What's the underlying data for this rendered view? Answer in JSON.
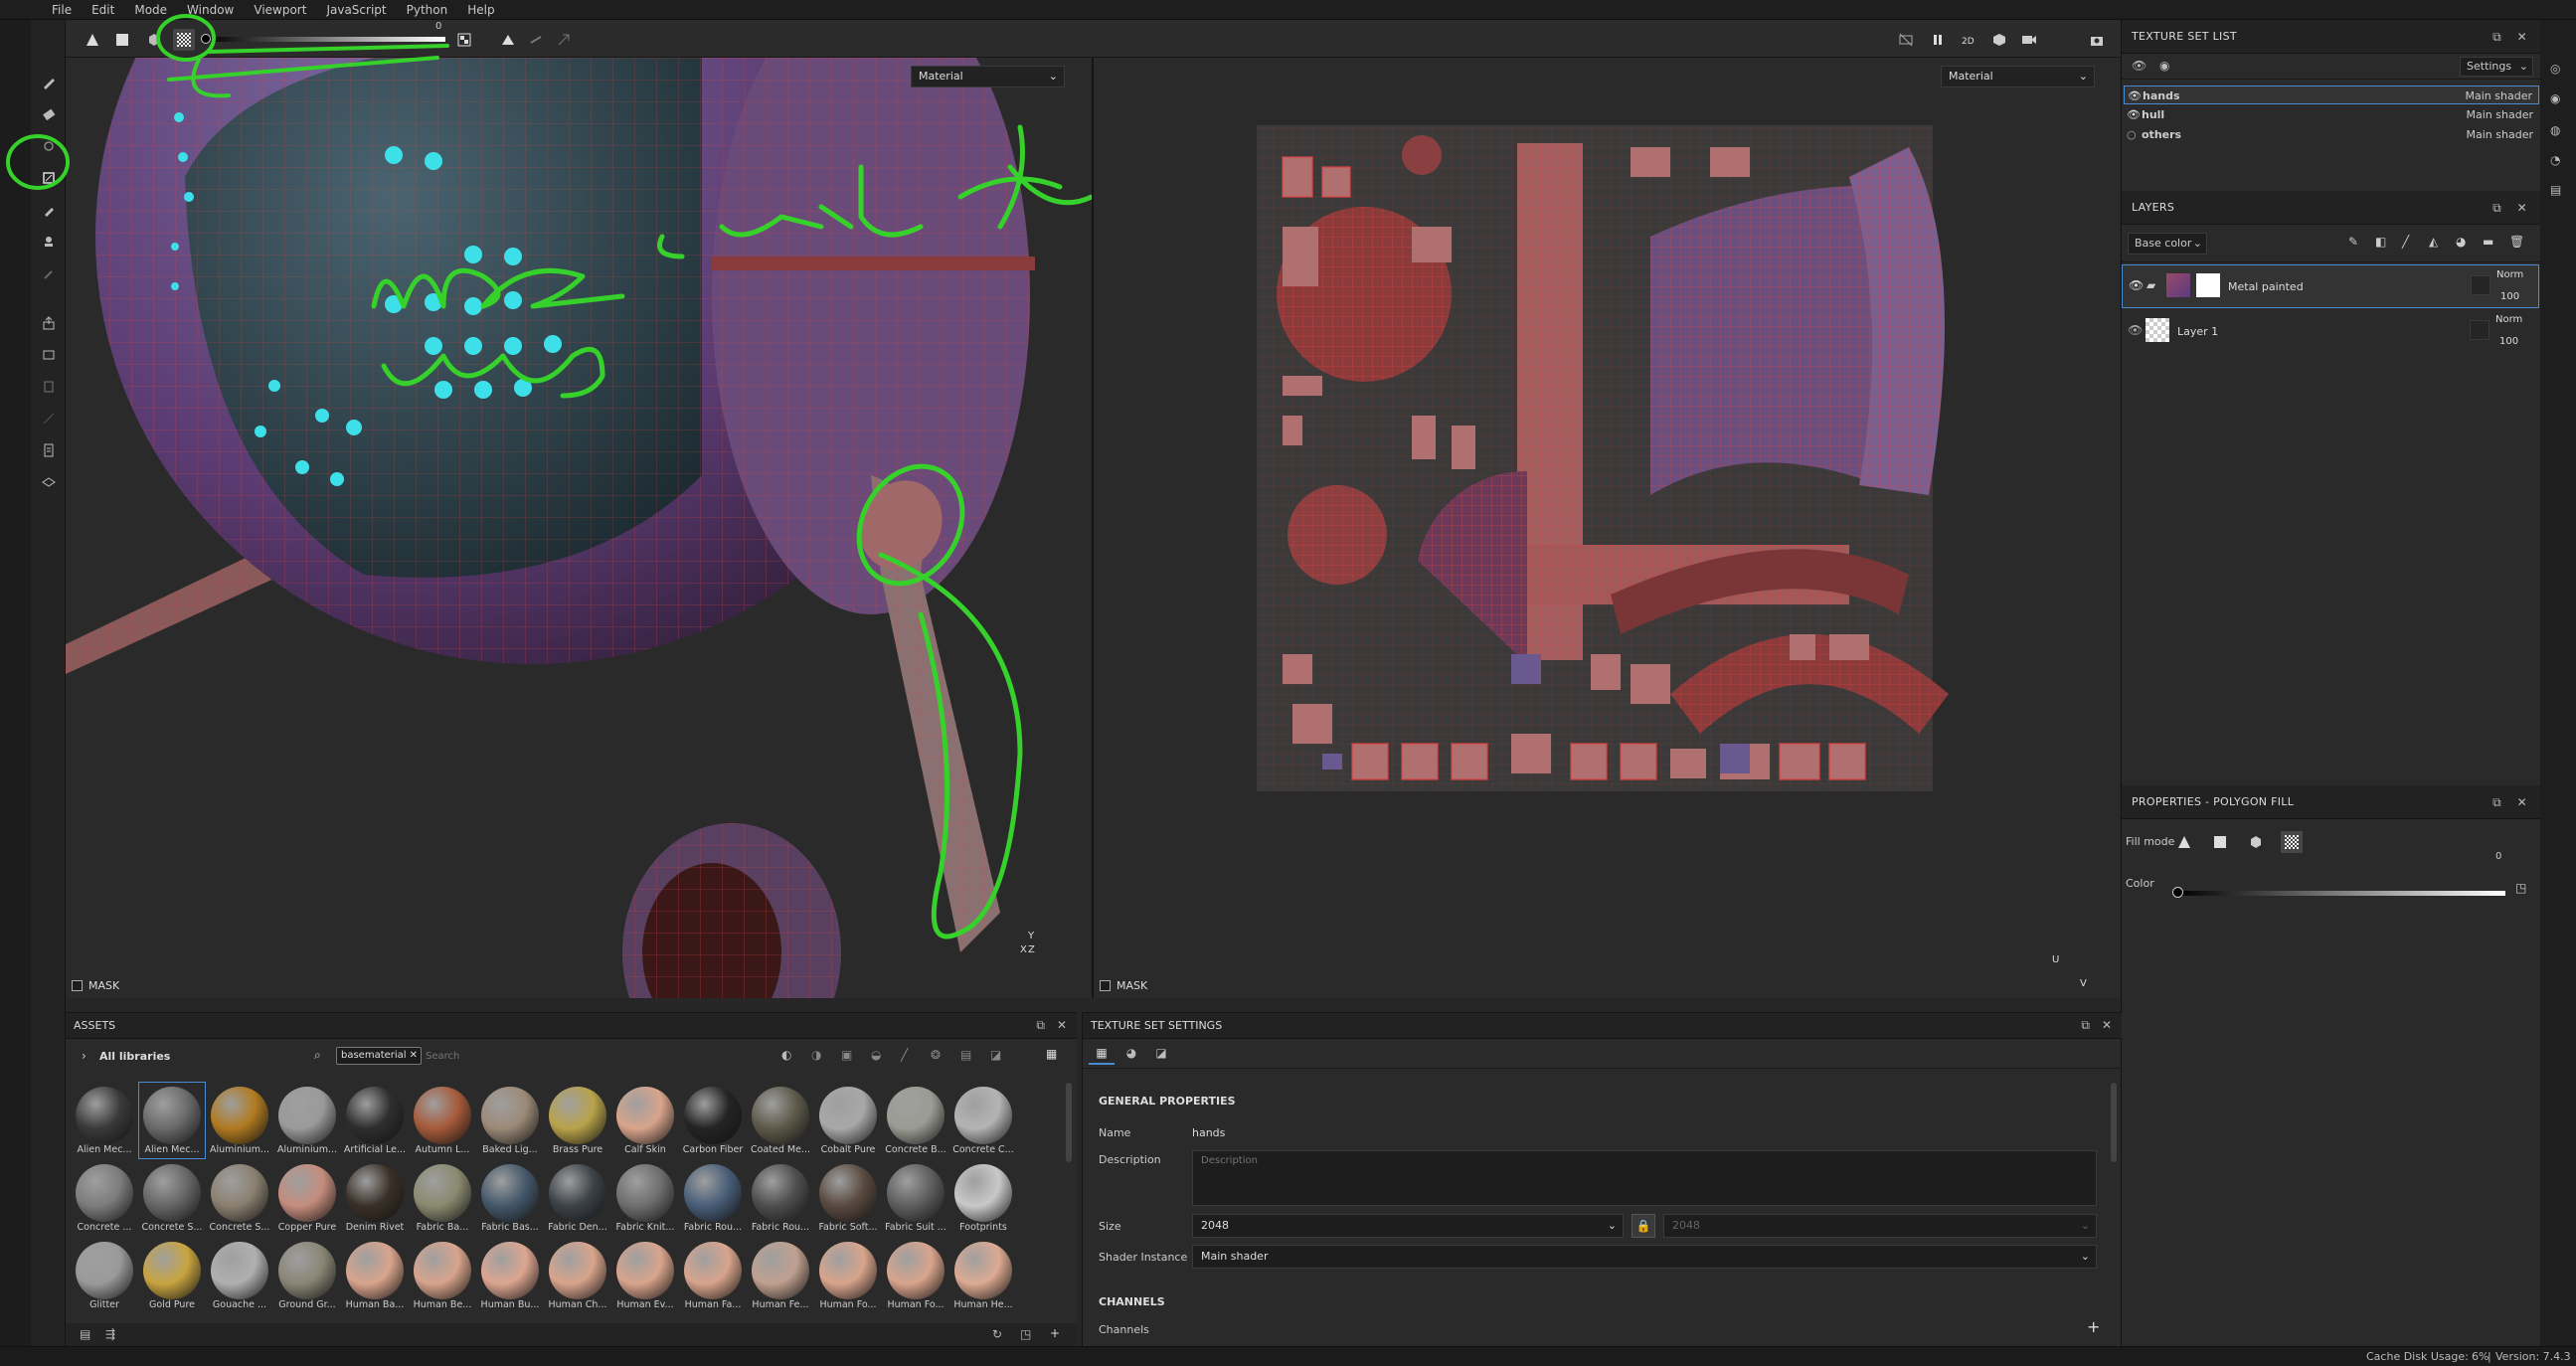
{
  "menu": [
    "File",
    "Edit",
    "Mode",
    "Window",
    "Viewport",
    "JavaScript",
    "Python",
    "Help"
  ],
  "toolbar": {
    "slider_value": "0"
  },
  "viewport_left": {
    "select": "Material",
    "mask_label": "MASK",
    "axis_x": "X",
    "axis_y": "Y",
    "axis_z": "Z"
  },
  "viewport_right": {
    "select": "Material",
    "mask_label": "MASK",
    "axis_u": "U",
    "axis_v": "V"
  },
  "annotations": {
    "line1": "mask cut the",
    "line2": "arms"
  },
  "texture_set_list": {
    "title": "TEXTURE SET LIST",
    "settings": "Settings",
    "rows": [
      {
        "name": "hands",
        "shader": "Main shader"
      },
      {
        "name": "hull",
        "shader": "Main shader"
      },
      {
        "name": "others",
        "shader": "Main shader"
      }
    ]
  },
  "layers": {
    "title": "LAYERS",
    "channel": "Base color",
    "rows": [
      {
        "name": "Metal painted",
        "blend": "Norm",
        "opacity": "100"
      },
      {
        "name": "Layer 1",
        "blend": "Norm",
        "opacity": "100"
      }
    ]
  },
  "properties": {
    "title": "PROPERTIES - POLYGON FILL",
    "fill_mode_label": "Fill mode",
    "color_label": "Color",
    "color_value": "0"
  },
  "assets": {
    "title": "ASSETS",
    "libraries": "All libraries",
    "search_tag": "basematerial",
    "search_placeholder": "Search",
    "items": [
      {
        "label": "Alien Mec...",
        "color": "#3a3a3a"
      },
      {
        "label": "Alien Mec...",
        "color": "#6a6a6a"
      },
      {
        "label": "Aluminium...",
        "color": "#b07a20"
      },
      {
        "label": "Aluminium...",
        "color": "#9a9a9a"
      },
      {
        "label": "Artificial Le...",
        "color": "#2e2e2e"
      },
      {
        "label": "Autumn L...",
        "color": "#a65a3a"
      },
      {
        "label": "Baked Lig...",
        "color": "#9c8a78"
      },
      {
        "label": "Brass Pure",
        "color": "#b8a24a"
      },
      {
        "label": "Calf Skin",
        "color": "#d8a48c"
      },
      {
        "label": "Carbon Fiber",
        "color": "#242424"
      },
      {
        "label": "Coated Me...",
        "color": "#5e5a4a"
      },
      {
        "label": "Cobalt Pure",
        "color": "#a8a8a8"
      },
      {
        "label": "Concrete B...",
        "color": "#9c9c94"
      },
      {
        "label": "Concrete C...",
        "color": "#b4b4b4"
      },
      {
        "label": "Concrete ...",
        "color": "#7c7c7c"
      },
      {
        "label": "Concrete S...",
        "color": "#666666"
      },
      {
        "label": "Concrete S...",
        "color": "#8a8070"
      },
      {
        "label": "Copper Pure",
        "color": "#c48c7c"
      },
      {
        "label": "Denim Rivet",
        "color": "#3a3028"
      },
      {
        "label": "Fabric Ba...",
        "color": "#8a8a70"
      },
      {
        "label": "Fabric Bas...",
        "color": "#44586a"
      },
      {
        "label": "Fabric Den...",
        "color": "#3c4248"
      },
      {
        "label": "Fabric Knit...",
        "color": "#6e6e6e"
      },
      {
        "label": "Fabric Rou...",
        "color": "#485e78"
      },
      {
        "label": "Fabric Rou...",
        "color": "#4e4e4e"
      },
      {
        "label": "Fabric Soft...",
        "color": "#5a4a40"
      },
      {
        "label": "Fabric Suit ...",
        "color": "#5e5e5e"
      },
      {
        "label": "Footprints",
        "color": "#c8c8c8"
      },
      {
        "label": "Glitter",
        "color": "#9a9a9a"
      },
      {
        "label": "Gold Pure",
        "color": "#c8a440"
      },
      {
        "label": "Gouache ...",
        "color": "#b0b0b0"
      },
      {
        "label": "Ground Gr...",
        "color": "#8a8676"
      },
      {
        "label": "Human Ba...",
        "color": "#d8a48c"
      },
      {
        "label": "Human Be...",
        "color": "#d8a48c"
      },
      {
        "label": "Human Bu...",
        "color": "#dca690"
      },
      {
        "label": "Human Ch...",
        "color": "#d8a48c"
      },
      {
        "label": "Human Ev...",
        "color": "#d8a48c"
      },
      {
        "label": "Human Fa...",
        "color": "#d8a48c"
      },
      {
        "label": "Human Fe...",
        "color": "#c0a090"
      },
      {
        "label": "Human Fo...",
        "color": "#d8a48c"
      },
      {
        "label": "Human Fo...",
        "color": "#d8a48c"
      },
      {
        "label": "Human He...",
        "color": "#dcaa92"
      }
    ]
  },
  "texture_set_settings": {
    "title": "TEXTURE SET SETTINGS",
    "general": "GENERAL PROPERTIES",
    "name_label": "Name",
    "name_value": "hands",
    "description_label": "Description",
    "description_placeholder": "Description",
    "size_label": "Size",
    "size_value": "2048",
    "size_value2": "2048",
    "shader_label": "Shader Instance",
    "shader_value": "Main shader",
    "channels_header": "CHANNELS",
    "channels_label": "Channels"
  },
  "status": {
    "cache": "Cache Disk Usage:",
    "usage": "6%",
    "version": "Version: 7.4.3"
  },
  "colors": {
    "annotation": "#36d12a",
    "wire": "#d03030",
    "accent": "#4aa8ff",
    "dots": "#3de0e8"
  }
}
